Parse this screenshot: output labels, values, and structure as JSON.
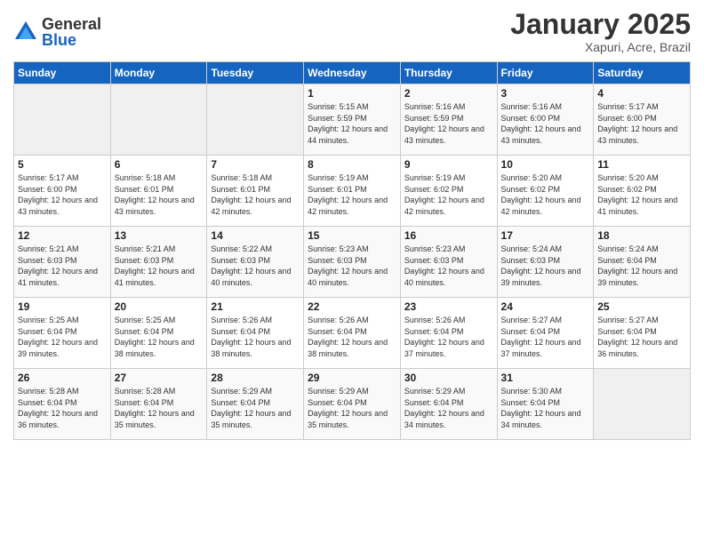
{
  "header": {
    "logo_general": "General",
    "logo_blue": "Blue",
    "title": "January 2025",
    "subtitle": "Xapuri, Acre, Brazil"
  },
  "weekdays": [
    "Sunday",
    "Monday",
    "Tuesday",
    "Wednesday",
    "Thursday",
    "Friday",
    "Saturday"
  ],
  "weeks": [
    [
      {
        "day": "",
        "sunrise": "",
        "sunset": "",
        "daylight": ""
      },
      {
        "day": "",
        "sunrise": "",
        "sunset": "",
        "daylight": ""
      },
      {
        "day": "",
        "sunrise": "",
        "sunset": "",
        "daylight": ""
      },
      {
        "day": "1",
        "sunrise": "Sunrise: 5:15 AM",
        "sunset": "Sunset: 5:59 PM",
        "daylight": "Daylight: 12 hours and 44 minutes."
      },
      {
        "day": "2",
        "sunrise": "Sunrise: 5:16 AM",
        "sunset": "Sunset: 5:59 PM",
        "daylight": "Daylight: 12 hours and 43 minutes."
      },
      {
        "day": "3",
        "sunrise": "Sunrise: 5:16 AM",
        "sunset": "Sunset: 6:00 PM",
        "daylight": "Daylight: 12 hours and 43 minutes."
      },
      {
        "day": "4",
        "sunrise": "Sunrise: 5:17 AM",
        "sunset": "Sunset: 6:00 PM",
        "daylight": "Daylight: 12 hours and 43 minutes."
      }
    ],
    [
      {
        "day": "5",
        "sunrise": "Sunrise: 5:17 AM",
        "sunset": "Sunset: 6:00 PM",
        "daylight": "Daylight: 12 hours and 43 minutes."
      },
      {
        "day": "6",
        "sunrise": "Sunrise: 5:18 AM",
        "sunset": "Sunset: 6:01 PM",
        "daylight": "Daylight: 12 hours and 43 minutes."
      },
      {
        "day": "7",
        "sunrise": "Sunrise: 5:18 AM",
        "sunset": "Sunset: 6:01 PM",
        "daylight": "Daylight: 12 hours and 42 minutes."
      },
      {
        "day": "8",
        "sunrise": "Sunrise: 5:19 AM",
        "sunset": "Sunset: 6:01 PM",
        "daylight": "Daylight: 12 hours and 42 minutes."
      },
      {
        "day": "9",
        "sunrise": "Sunrise: 5:19 AM",
        "sunset": "Sunset: 6:02 PM",
        "daylight": "Daylight: 12 hours and 42 minutes."
      },
      {
        "day": "10",
        "sunrise": "Sunrise: 5:20 AM",
        "sunset": "Sunset: 6:02 PM",
        "daylight": "Daylight: 12 hours and 42 minutes."
      },
      {
        "day": "11",
        "sunrise": "Sunrise: 5:20 AM",
        "sunset": "Sunset: 6:02 PM",
        "daylight": "Daylight: 12 hours and 41 minutes."
      }
    ],
    [
      {
        "day": "12",
        "sunrise": "Sunrise: 5:21 AM",
        "sunset": "Sunset: 6:03 PM",
        "daylight": "Daylight: 12 hours and 41 minutes."
      },
      {
        "day": "13",
        "sunrise": "Sunrise: 5:21 AM",
        "sunset": "Sunset: 6:03 PM",
        "daylight": "Daylight: 12 hours and 41 minutes."
      },
      {
        "day": "14",
        "sunrise": "Sunrise: 5:22 AM",
        "sunset": "Sunset: 6:03 PM",
        "daylight": "Daylight: 12 hours and 40 minutes."
      },
      {
        "day": "15",
        "sunrise": "Sunrise: 5:23 AM",
        "sunset": "Sunset: 6:03 PM",
        "daylight": "Daylight: 12 hours and 40 minutes."
      },
      {
        "day": "16",
        "sunrise": "Sunrise: 5:23 AM",
        "sunset": "Sunset: 6:03 PM",
        "daylight": "Daylight: 12 hours and 40 minutes."
      },
      {
        "day": "17",
        "sunrise": "Sunrise: 5:24 AM",
        "sunset": "Sunset: 6:03 PM",
        "daylight": "Daylight: 12 hours and 39 minutes."
      },
      {
        "day": "18",
        "sunrise": "Sunrise: 5:24 AM",
        "sunset": "Sunset: 6:04 PM",
        "daylight": "Daylight: 12 hours and 39 minutes."
      }
    ],
    [
      {
        "day": "19",
        "sunrise": "Sunrise: 5:25 AM",
        "sunset": "Sunset: 6:04 PM",
        "daylight": "Daylight: 12 hours and 39 minutes."
      },
      {
        "day": "20",
        "sunrise": "Sunrise: 5:25 AM",
        "sunset": "Sunset: 6:04 PM",
        "daylight": "Daylight: 12 hours and 38 minutes."
      },
      {
        "day": "21",
        "sunrise": "Sunrise: 5:26 AM",
        "sunset": "Sunset: 6:04 PM",
        "daylight": "Daylight: 12 hours and 38 minutes."
      },
      {
        "day": "22",
        "sunrise": "Sunrise: 5:26 AM",
        "sunset": "Sunset: 6:04 PM",
        "daylight": "Daylight: 12 hours and 38 minutes."
      },
      {
        "day": "23",
        "sunrise": "Sunrise: 5:26 AM",
        "sunset": "Sunset: 6:04 PM",
        "daylight": "Daylight: 12 hours and 37 minutes."
      },
      {
        "day": "24",
        "sunrise": "Sunrise: 5:27 AM",
        "sunset": "Sunset: 6:04 PM",
        "daylight": "Daylight: 12 hours and 37 minutes."
      },
      {
        "day": "25",
        "sunrise": "Sunrise: 5:27 AM",
        "sunset": "Sunset: 6:04 PM",
        "daylight": "Daylight: 12 hours and 36 minutes."
      }
    ],
    [
      {
        "day": "26",
        "sunrise": "Sunrise: 5:28 AM",
        "sunset": "Sunset: 6:04 PM",
        "daylight": "Daylight: 12 hours and 36 minutes."
      },
      {
        "day": "27",
        "sunrise": "Sunrise: 5:28 AM",
        "sunset": "Sunset: 6:04 PM",
        "daylight": "Daylight: 12 hours and 35 minutes."
      },
      {
        "day": "28",
        "sunrise": "Sunrise: 5:29 AM",
        "sunset": "Sunset: 6:04 PM",
        "daylight": "Daylight: 12 hours and 35 minutes."
      },
      {
        "day": "29",
        "sunrise": "Sunrise: 5:29 AM",
        "sunset": "Sunset: 6:04 PM",
        "daylight": "Daylight: 12 hours and 35 minutes."
      },
      {
        "day": "30",
        "sunrise": "Sunrise: 5:29 AM",
        "sunset": "Sunset: 6:04 PM",
        "daylight": "Daylight: 12 hours and 34 minutes."
      },
      {
        "day": "31",
        "sunrise": "Sunrise: 5:30 AM",
        "sunset": "Sunset: 6:04 PM",
        "daylight": "Daylight: 12 hours and 34 minutes."
      },
      {
        "day": "",
        "sunrise": "",
        "sunset": "",
        "daylight": ""
      }
    ]
  ]
}
